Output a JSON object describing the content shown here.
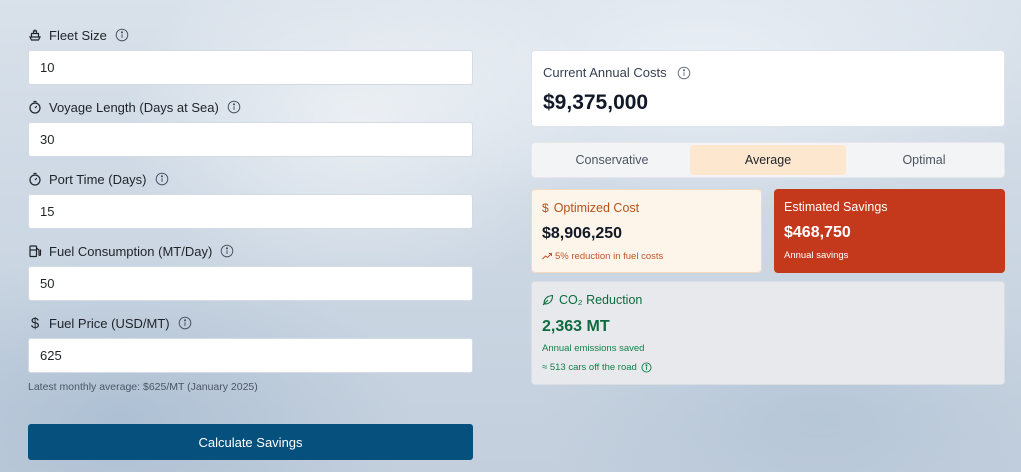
{
  "form": {
    "fields": [
      {
        "label": "Fleet Size",
        "icon": "ship-icon",
        "value": "10"
      },
      {
        "label": "Voyage Length (Days at Sea)",
        "icon": "stopwatch-icon",
        "value": "30"
      },
      {
        "label": "Port Time (Days)",
        "icon": "stopwatch-icon",
        "value": "15"
      },
      {
        "label": "Fuel Consumption (MT/Day)",
        "icon": "fuel-pump-icon",
        "value": "50"
      },
      {
        "label": "Fuel Price (USD/MT)",
        "icon": "dollar-icon",
        "value": "625"
      }
    ],
    "hint": "Latest monthly average: $625/MT (January 2025)",
    "button_label": "Calculate Savings"
  },
  "current": {
    "title": "Current Annual Costs",
    "value": "$9,375,000"
  },
  "tabs": [
    {
      "label": "Conservative",
      "active": false
    },
    {
      "label": "Average",
      "active": true
    },
    {
      "label": "Optimal",
      "active": false
    }
  ],
  "optimized": {
    "title": "Optimized Cost",
    "value": "$8,906,250",
    "note": "5% reduction in fuel costs"
  },
  "savings": {
    "title": "Estimated Savings",
    "value": "$468,750",
    "note": "Annual savings"
  },
  "co2": {
    "title": "CO₂ Reduction",
    "value": "2,363 MT",
    "note1": "Annual emissions saved",
    "note2": "≈ 513 cars off the road"
  },
  "colors": {
    "primary_button": "#05507d",
    "savings_card": "#c4391b",
    "optimized_accent": "#b5521a",
    "co2_green": "#0d6b3f",
    "active_tab": "#fde8cf"
  }
}
